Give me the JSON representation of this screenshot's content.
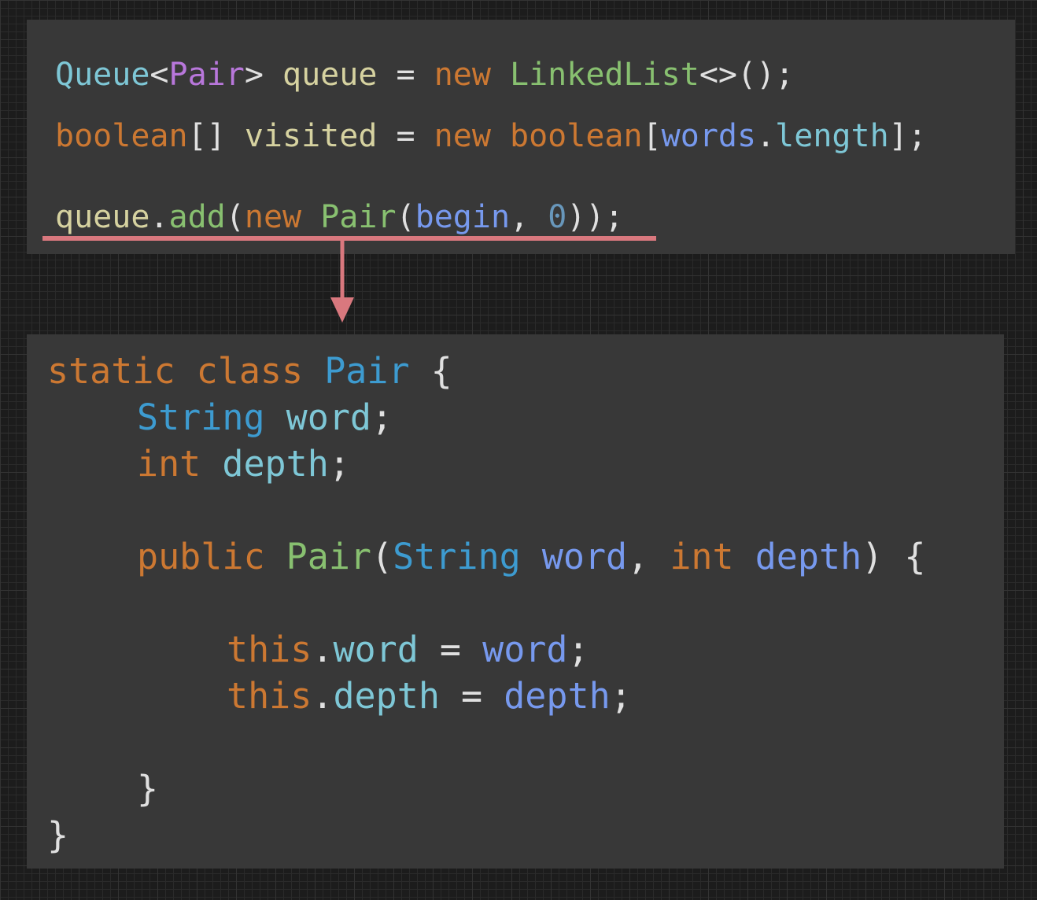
{
  "colors": {
    "keyword": "#cc7832",
    "type": "#7ec7d6",
    "generic": "#b877db",
    "variable": "#d6d2a0",
    "method": "#88c070",
    "parameter": "#7799ee",
    "class_name": "#3d9bd0",
    "number": "#6897bb",
    "highlight": "#d9787e",
    "panel_background": "#383838"
  },
  "top_code": {
    "line1": {
      "t1": "Queue",
      "t2": "<",
      "t3": "Pair",
      "t4": ">",
      "t5": " queue",
      "t6": " = ",
      "t7": "new",
      "t8": " LinkedList",
      "t9": "<>();"
    },
    "line2": {
      "t1": "boolean",
      "t2": "[] ",
      "t3": "visited",
      "t4": " = ",
      "t5": "new",
      "t6": " boolean",
      "t7": "[",
      "t8": "words",
      "t9": ".",
      "t10": "length",
      "t11": "];"
    },
    "line3": {
      "t1": "queue",
      "t2": ".",
      "t3": "add",
      "t4": "(",
      "t5": "new",
      "t6": " Pair",
      "t7": "(",
      "t8": "begin",
      "t9": ", ",
      "t10": "0",
      "t11": "));"
    }
  },
  "bottom_code": {
    "line1": {
      "t1": "static",
      "t2": " class",
      "t3": " Pair",
      "t4": " {"
    },
    "line2": {
      "t1": "String",
      "t2": " word",
      "t3": ";"
    },
    "line3": {
      "t1": "int",
      "t2": " depth",
      "t3": ";"
    },
    "line4": {
      "t1": "public",
      "t2": " Pair",
      "t3": "(",
      "t4": "String",
      "t5": " word",
      "t6": ", ",
      "t7": "int",
      "t8": " depth",
      "t9": ") {"
    },
    "line5": {
      "t1": "this",
      "t2": ".",
      "t3": "word",
      "t4": " = ",
      "t5": "word",
      "t6": ";"
    },
    "line6": {
      "t1": "this",
      "t2": ".",
      "t3": "depth",
      "t4": " = ",
      "t5": "depth",
      "t6": ";"
    },
    "line7": {
      "t1": "}"
    },
    "line8": {
      "t1": "}"
    }
  }
}
